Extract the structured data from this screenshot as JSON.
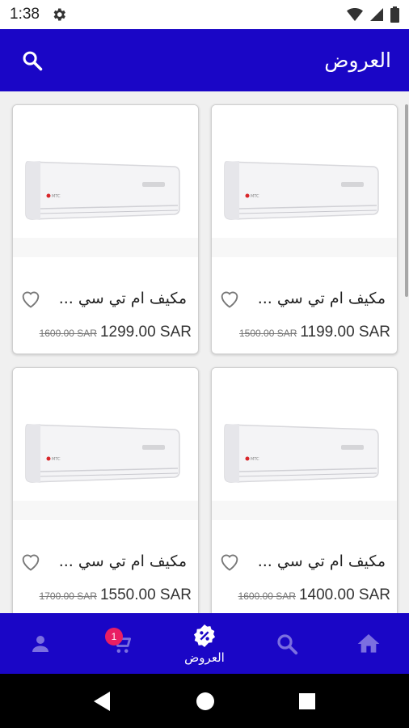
{
  "status_bar": {
    "time": "1:38"
  },
  "app_bar": {
    "title": "العروض"
  },
  "products": [
    {
      "title": "مكيف ام تي سي ...",
      "price": "1199.00 SAR",
      "old_price": "1500.00 SAR"
    },
    {
      "title": "مكيف ام تي سي ...",
      "price": "1299.00 SAR",
      "old_price": "1600.00 SAR"
    },
    {
      "title": "مكيف ام تي سي ...",
      "price": "1400.00 SAR",
      "old_price": "1600.00 SAR"
    },
    {
      "title": "مكيف ام تي سي ...",
      "price": "1550.00 SAR",
      "old_price": "1700.00 SAR"
    }
  ],
  "bottom_nav": {
    "cart_badge": "1",
    "offers_label": "العروض",
    "active": "offers"
  },
  "colors": {
    "primary": "#1a06c6",
    "inactive_icon": "#7b6fe0",
    "badge": "#e91e63"
  },
  "icons": [
    "settings-icon",
    "wifi-icon",
    "signal-icon",
    "battery-icon",
    "search-icon",
    "heart-icon",
    "home-icon",
    "search-icon",
    "discount-icon",
    "cart-icon",
    "person-icon",
    "back-icon",
    "home-circle-icon",
    "recents-icon"
  ]
}
